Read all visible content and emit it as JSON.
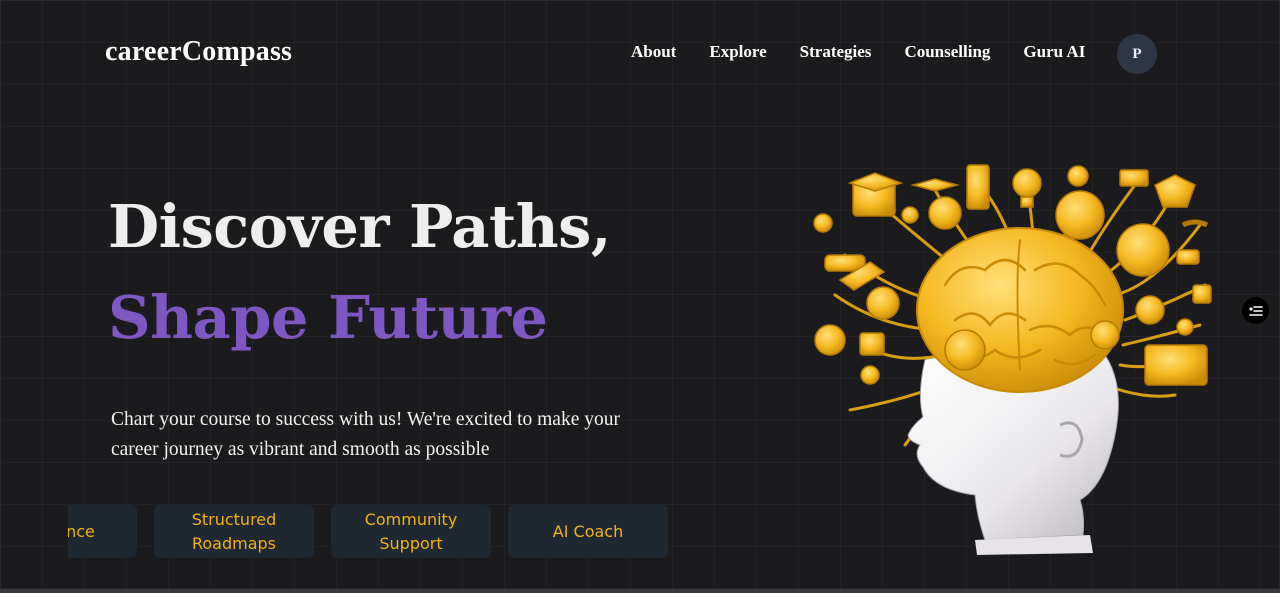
{
  "header": {
    "logo": "careerCompass",
    "nav": [
      "About",
      "Explore",
      "Strategies",
      "Counselling",
      "Guru AI"
    ],
    "avatar_initial": "P"
  },
  "hero": {
    "line1": "Discover Paths,",
    "line2": "Shape Future",
    "description": "Chart your course to success with us! We're excited to make your career journey as vibrant and smooth as possible"
  },
  "features": [
    "Guidance",
    "Structured Roadmaps",
    "Community Support",
    "AI Coach"
  ],
  "illustration": {
    "icon": "brain-head-icon"
  },
  "side_button": {
    "icon": "filter-list-icon"
  },
  "colors": {
    "background": "#1b1b1d",
    "accent_purple": "#7e57c2",
    "feature_text": "#f2b01e",
    "card_bg": "#1f2730",
    "avatar_bg": "#2e3646"
  }
}
